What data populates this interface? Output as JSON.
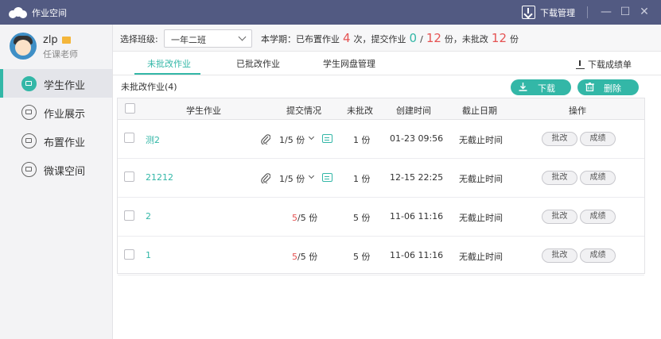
{
  "window": {
    "title": "作业空间",
    "download_manager_label": "下载管理",
    "minimize_glyph": "—",
    "maximize_glyph": "☐",
    "close_glyph": "✕"
  },
  "profile": {
    "name": "zlp",
    "role": "任课老师"
  },
  "sidebar": {
    "items": [
      {
        "label": "学生作业",
        "icon": "layers-icon",
        "active": true
      },
      {
        "label": "作业展示",
        "icon": "trophy-icon",
        "active": false
      },
      {
        "label": "布置作业",
        "icon": "edit-icon",
        "active": false
      },
      {
        "label": "微课空间",
        "icon": "play-icon",
        "active": false
      }
    ]
  },
  "topbar": {
    "class_select_label": "选择班级:",
    "class_selected": "一年二班",
    "stats_prefix": "本学期：已布置作业",
    "assigned_count": "4",
    "stats_mid1": "次，提交作业",
    "submitted_count": "0",
    "stats_slash": "/",
    "total_count": "12",
    "stats_mid2": "份，未批改",
    "ungraded_count": "12",
    "stats_suffix": "份"
  },
  "tabs": [
    {
      "label": "未批改作业",
      "active": true
    },
    {
      "label": "已批改作业",
      "active": false
    },
    {
      "label": "学生网盘管理",
      "active": false
    }
  ],
  "download_grades_label": "下载成绩单",
  "list_title": "未批改作业(4)",
  "buttons": {
    "download": "下载",
    "delete": "删除"
  },
  "table": {
    "headers": [
      "学生作业",
      "提交情况",
      "未批改",
      "创建时间",
      "截止日期",
      "操作"
    ],
    "rows": [
      {
        "name": "测2",
        "submitted": "1",
        "total_text": "/5 份",
        "has_attachment": true,
        "ungraded": "1 份",
        "created": "01-23 09:56",
        "deadline": "无截止时间",
        "grade_btn": "批改",
        "score_btn": "成绩"
      },
      {
        "name": "21212",
        "submitted": "1",
        "total_text": "/5 份",
        "has_attachment": true,
        "ungraded": "1 份",
        "created": "12-15 22:25",
        "deadline": "无截止时间",
        "grade_btn": "批改",
        "score_btn": "成绩"
      },
      {
        "name": "2",
        "submitted": "5",
        "total_text": "/5 份",
        "has_attachment": false,
        "ungraded": "5 份",
        "created": "11-06 11:16",
        "deadline": "无截止时间",
        "grade_btn": "批改",
        "score_btn": "成绩"
      },
      {
        "name": "1",
        "submitted": "5",
        "total_text": "/5 份",
        "has_attachment": false,
        "ungraded": "5 份",
        "created": "11-06 11:16",
        "deadline": "无截止时间",
        "grade_btn": "批改",
        "score_btn": "成绩"
      }
    ]
  },
  "colors": {
    "titlebar": "#525a82",
    "accent": "#33b7a7",
    "highlight": "#e55353"
  }
}
